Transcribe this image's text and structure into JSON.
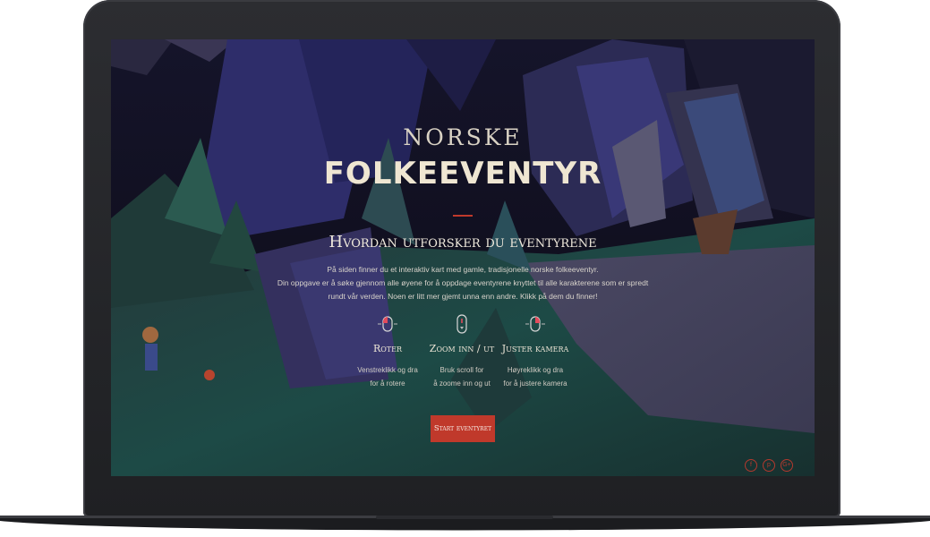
{
  "hero": {
    "title_small": "NORSKE",
    "title_big": "FOLKEEVENTYR",
    "heading": "Hvordan utforsker du eventyrene",
    "intro": [
      "På siden finner du et interaktiv kart med gamle, tradisjonelle norske folkeeventyr.",
      "Din oppgave er å søke gjennom alle øyene for å oppdage eventyrene knyttet til alle karakterene som er spredt",
      "rundt vår verden. Noen er litt mer gjemt unna enn andre. Klikk på dem du finner!"
    ]
  },
  "controls": [
    {
      "icon": "mouse-left-click-icon",
      "title": "Roter",
      "desc": [
        "Venstreklikk og dra",
        "for å rotere"
      ]
    },
    {
      "icon": "mouse-scroll-icon",
      "title": "Zoom inn / ut",
      "desc": [
        "Bruk scroll for",
        "å zoome inn og ut"
      ]
    },
    {
      "icon": "mouse-right-click-icon",
      "title": "Juster kamera",
      "desc": [
        "Høyreklikk og dra",
        "for å justere kamera"
      ]
    }
  ],
  "start_button": "Start eventyret",
  "social": [
    {
      "icon": "facebook-icon",
      "glyph": "f"
    },
    {
      "icon": "pinterest-icon",
      "glyph": "p"
    },
    {
      "icon": "google-plus-icon",
      "glyph": "G+"
    }
  ],
  "colors": {
    "accent": "#c0392b",
    "text": "#efe6d2",
    "bezel": "#232428"
  }
}
